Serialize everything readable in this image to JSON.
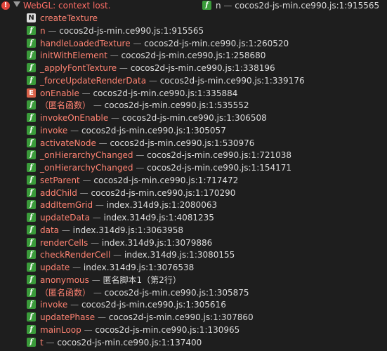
{
  "error": {
    "icon": "error-icon",
    "message": "WebGL: context lost."
  },
  "top_ref": {
    "badge": "f",
    "function": "n",
    "separator": " — ",
    "location": "cocos2d-js-min.ce990.js:1:915565"
  },
  "frames": [
    {
      "badge": "N",
      "function": "createTexture",
      "location": ""
    },
    {
      "badge": "f",
      "function": "n",
      "location": "cocos2d-js-min.ce990.js:1:915565"
    },
    {
      "badge": "f",
      "function": "handleLoadedTexture",
      "location": "cocos2d-js-min.ce990.js:1:260520"
    },
    {
      "badge": "f",
      "function": "initWithElement",
      "location": "cocos2d-js-min.ce990.js:1:258680"
    },
    {
      "badge": "f",
      "function": "_applyFontTexture",
      "location": "cocos2d-js-min.ce990.js:1:338196"
    },
    {
      "badge": "f",
      "function": "_forceUpdateRenderData",
      "location": "cocos2d-js-min.ce990.js:1:339176"
    },
    {
      "badge": "E",
      "function": "onEnable",
      "location": "cocos2d-js-min.ce990.js:1:335884"
    },
    {
      "badge": "f",
      "function": "（匿名函数）",
      "location": "cocos2d-js-min.ce990.js:1:535552"
    },
    {
      "badge": "f",
      "function": "invokeOnEnable",
      "location": "cocos2d-js-min.ce990.js:1:306508"
    },
    {
      "badge": "f",
      "function": "invoke",
      "location": "cocos2d-js-min.ce990.js:1:305057"
    },
    {
      "badge": "f",
      "function": "activateNode",
      "location": "cocos2d-js-min.ce990.js:1:530976"
    },
    {
      "badge": "f",
      "function": "_onHierarchyChanged",
      "location": "cocos2d-js-min.ce990.js:1:721038"
    },
    {
      "badge": "f",
      "function": "_onHierarchyChanged",
      "location": "cocos2d-js-min.ce990.js:1:154171"
    },
    {
      "badge": "f",
      "function": "setParent",
      "location": "cocos2d-js-min.ce990.js:1:717472"
    },
    {
      "badge": "f",
      "function": "addChild",
      "location": "cocos2d-js-min.ce990.js:1:170290"
    },
    {
      "badge": "f",
      "function": "addItemGrid",
      "location": "index.314d9.js:1:2080063"
    },
    {
      "badge": "f",
      "function": "updateData",
      "location": "index.314d9.js:1:4081235"
    },
    {
      "badge": "f",
      "function": "data",
      "location": "index.314d9.js:1:3063958"
    },
    {
      "badge": "f",
      "function": "renderCells",
      "location": "index.314d9.js:1:3079886"
    },
    {
      "badge": "f",
      "function": "checkRenderCell",
      "location": "index.314d9.js:1:3080155"
    },
    {
      "badge": "f",
      "function": "update",
      "location": "index.314d9.js:1:3076538"
    },
    {
      "badge": "f",
      "function": "anonymous",
      "location": "匿名脚本1（第2行）"
    },
    {
      "badge": "f",
      "function": "（匿名函数）",
      "location": "cocos2d-js-min.ce990.js:1:305875"
    },
    {
      "badge": "f",
      "function": "invoke",
      "location": "cocos2d-js-min.ce990.js:1:305616"
    },
    {
      "badge": "f",
      "function": "updatePhase",
      "location": "cocos2d-js-min.ce990.js:1:307860"
    },
    {
      "badge": "f",
      "function": "mainLoop",
      "location": "cocos2d-js-min.ce990.js:1:130965"
    },
    {
      "badge": "f",
      "function": "t",
      "location": "cocos2d-js-min.ce990.js:1:137400"
    }
  ],
  "separator": " — ",
  "colors": {
    "background": "#1e1e1e",
    "error": "#ff6e66",
    "function_name": "#ff8372",
    "function_badge": "#3a9b3a",
    "native_badge": "#dedede",
    "event_badge": "#d9624a"
  }
}
